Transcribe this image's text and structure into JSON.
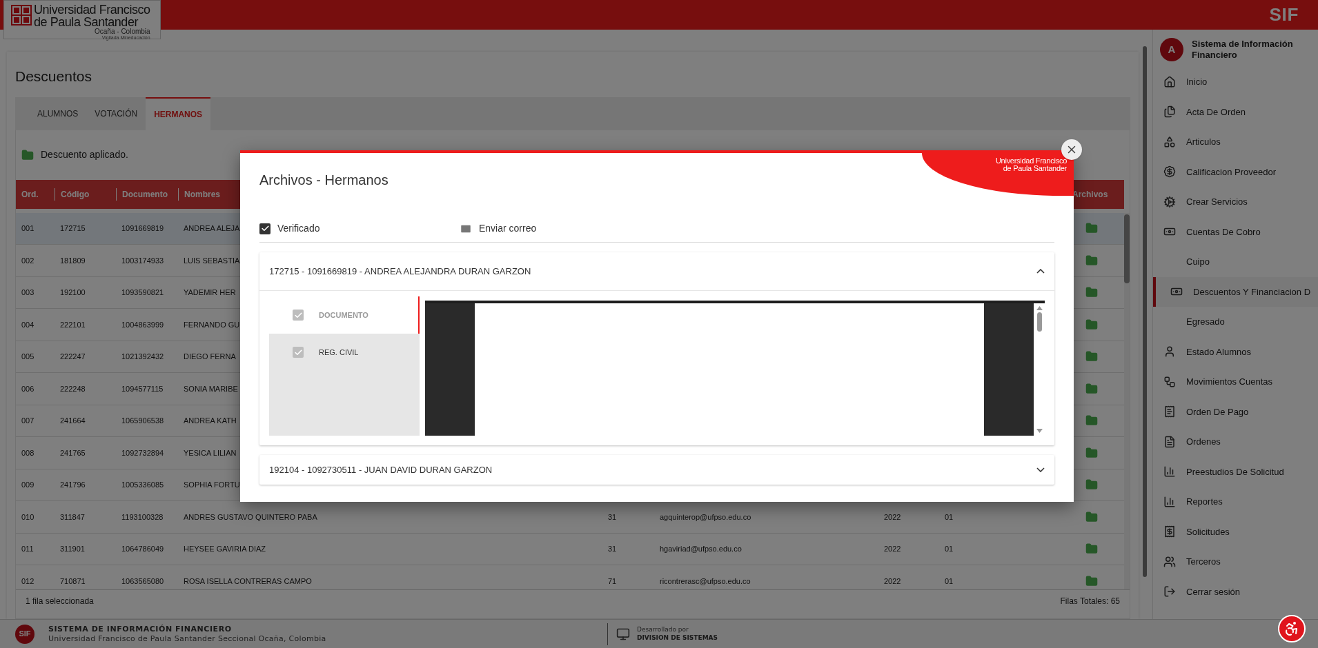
{
  "header": {
    "logo_lines": [
      "Universidad Francisco",
      "de Paula Santander",
      "Ocaña - Colombia",
      "Vigilada Mineducación"
    ],
    "app_mark": "SIF"
  },
  "page": {
    "title": "Descuentos",
    "tabs": [
      {
        "label": "ALUMNOS",
        "selected": false
      },
      {
        "label": "VOTACIÓN",
        "selected": false
      },
      {
        "label": "HERMANOS",
        "selected": true
      }
    ],
    "message": "Descuento aplicado.",
    "table": {
      "columns": [
        "Ord.",
        "Código",
        "Documento",
        "Nombres",
        "Archivos"
      ],
      "rows": [
        {
          "selected": true,
          "ord": "001",
          "codigo": "172715",
          "documento": "1091669819",
          "nombres": "ANDREA ALEJA"
        },
        {
          "selected": false,
          "ord": "002",
          "codigo": "181809",
          "documento": "1003174933",
          "nombres": "LUIS SEBASTIA"
        },
        {
          "selected": false,
          "ord": "003",
          "codigo": "192100",
          "documento": "1093590821",
          "nombres": "YADEMIR HER"
        },
        {
          "selected": false,
          "ord": "004",
          "codigo": "222101",
          "documento": "1004863999",
          "nombres": "FERNANDO GU"
        },
        {
          "selected": false,
          "ord": "005",
          "codigo": "222247",
          "documento": "1021392432",
          "nombres": "DIEGO FERNA"
        },
        {
          "selected": false,
          "ord": "006",
          "codigo": "222248",
          "documento": "1094577115",
          "nombres": "SONIA MARIBE"
        },
        {
          "selected": false,
          "ord": "007",
          "codigo": "241664",
          "documento": "1065906538",
          "nombres": "ANDREA KATH"
        },
        {
          "selected": false,
          "ord": "008",
          "codigo": "241765",
          "documento": "1092732894",
          "nombres": "YESICA LILIAN"
        },
        {
          "selected": false,
          "ord": "009",
          "codigo": "241796",
          "documento": "1005336085",
          "nombres": "SOPHIA FORTU"
        },
        {
          "selected": false,
          "ord": "010",
          "codigo": "311847",
          "documento": "1193100328",
          "nombres": "ANDRES GUSTAVO QUINTERO PABA",
          "column_5": "31",
          "column_6": "agquinterop@ufpso.edu.co",
          "column_7": "2022",
          "column_8": "01"
        },
        {
          "selected": false,
          "ord": "011",
          "codigo": "311901",
          "documento": "1064786049",
          "nombres": "HEYSEE GAVIRIA DIAZ",
          "column_5": "31",
          "column_6": "hgaviriad@ufpso.edu.co",
          "column_7": "2022",
          "column_8": "01"
        },
        {
          "selected": false,
          "ord": "012",
          "codigo": "710871",
          "documento": "1063565080",
          "nombres": "ROSA ISELLA CONTRERAS CAMPO",
          "column_5": "71",
          "column_6": "ricontrerasc@ufpso.edu.co",
          "column_7": "2022",
          "column_8": "01"
        }
      ]
    },
    "selection_info": "1 fila seleccionada",
    "total": "Filas Totales: 65"
  },
  "sidebar": {
    "avatar": "A",
    "title": "Sistema de Información Financiero",
    "items": [
      {
        "label": "Inicio",
        "selected": false
      },
      {
        "label": "Acta De Orden",
        "selected": false
      },
      {
        "label": "Articulos",
        "selected": false
      },
      {
        "label": "Calificacion Proveedor",
        "selected": false
      },
      {
        "label": "Crear Servicios",
        "selected": false
      },
      {
        "label": "Cuentas De Cobro",
        "selected": false
      },
      {
        "label": "Cuipo",
        "selected": false
      },
      {
        "label": "Descuentos Y Financiacion D",
        "selected": true
      },
      {
        "label": "Egresado",
        "selected": false
      },
      {
        "label": "Estado Alumnos",
        "selected": false
      },
      {
        "label": "Movimientos Cuentas",
        "selected": false
      },
      {
        "label": "Orden De Pago",
        "selected": false
      },
      {
        "label": "Ordenes",
        "selected": false
      },
      {
        "label": "Preestudios De Solicitud",
        "selected": false
      },
      {
        "label": "Reportes",
        "selected": false
      },
      {
        "label": "Solicitudes",
        "selected": false
      },
      {
        "label": "Terceros",
        "selected": false
      },
      {
        "label": "Cerrar sesión",
        "selected": false
      }
    ]
  },
  "footer": {
    "logo": "SIF",
    "title": "SISTEMA DE INFORMACIÓN FINANCIERO",
    "subtitle": "Universidad Francisco de Paula Santander Seccional Ocaña, Colombia",
    "credit_label": "Desarrollado por",
    "credit": "DIVISION DE SISTEMAS"
  },
  "modal": {
    "title": "Archivos - Hermanos",
    "logo_lines": [
      "Universidad Francisco",
      "de Paula Santander"
    ],
    "verified": {
      "label": "Verificado",
      "checked": true
    },
    "send_email": "Enviar correo",
    "students": [
      {
        "label": "172715 - 1091669819 - ANDREA ALEJANDRA DURAN GARZON",
        "expanded": true,
        "documents": [
          {
            "label": "DOCUMENTO",
            "checked": true,
            "selected": true
          },
          {
            "label": "REG. CIVIL",
            "checked": true,
            "selected": false
          }
        ]
      },
      {
        "label": "192104 - 1092730511 - JUAN DAVID DURAN GARZON",
        "expanded": false
      }
    ]
  }
}
